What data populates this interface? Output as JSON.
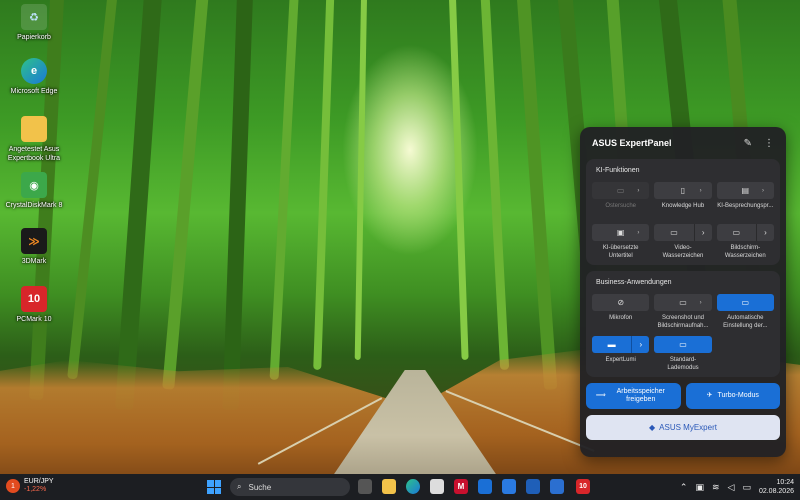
{
  "desktop": {
    "icons": [
      {
        "label": "Papierkorb",
        "icon": "recycle-bin-icon"
      },
      {
        "label": "Microsoft Edge",
        "icon": "edge-icon"
      },
      {
        "label": "Angetestet Asus Expertbook Ultra",
        "icon": "folder-icon"
      },
      {
        "label": "CrystalDiskMark 8",
        "icon": "crystaldiskmark-icon"
      },
      {
        "label": "3DMark",
        "icon": "3dmark-icon"
      },
      {
        "label": "PCMark 10",
        "icon": "pcmark-icon",
        "badge": "10"
      }
    ]
  },
  "panel": {
    "title": "ASUS ExpertPanel",
    "ai_section": {
      "title": "KI-Funktionen",
      "tiles": [
        {
          "label": "Ostersuche",
          "icon": "document-search-icon",
          "state": "disabled"
        },
        {
          "label": "Knowledge Hub",
          "icon": "book-icon",
          "state": "off"
        },
        {
          "label": "KI-Besprechungspr...",
          "icon": "meeting-notes-icon",
          "state": "off"
        },
        {
          "label": "KI-übersetzte Untertitel",
          "icon": "subtitle-icon",
          "state": "off"
        },
        {
          "label": "Video-Wasserzeichen",
          "icon": "video-watermark-icon",
          "state": "off"
        },
        {
          "label": "Bildschirm-Wasserzeichen",
          "icon": "screen-watermark-icon",
          "state": "off"
        }
      ]
    },
    "business_section": {
      "title": "Business-Anwendungen",
      "tiles": [
        {
          "label": "Mikrofon",
          "icon": "microphone-muted-icon",
          "state": "off"
        },
        {
          "label": "Screenshot und Bildschirmaufnah...",
          "icon": "screenshot-icon",
          "state": "off"
        },
        {
          "label": "Automatische Einstellung der...",
          "icon": "auto-adjust-icon",
          "state": "on"
        },
        {
          "label": "ExpertLumi",
          "icon": "expertlumi-icon",
          "state": "on"
        },
        {
          "label": "Standard-Lademodus",
          "icon": "battery-charge-icon",
          "state": "on"
        }
      ]
    },
    "memory_button": "Arbeitsspeicher freigeben",
    "turbo_button": "Turbo-Modus",
    "myexpert_button": "ASUS MyExpert"
  },
  "taskbar": {
    "ticker_badge": "1",
    "ticker_symbol": "EUR/JPY",
    "ticker_change": "-1,22%",
    "search_placeholder": "Suche",
    "clock_time": "10:24",
    "clock_date": "02.08.2026",
    "accent": "#1a6fd6"
  }
}
